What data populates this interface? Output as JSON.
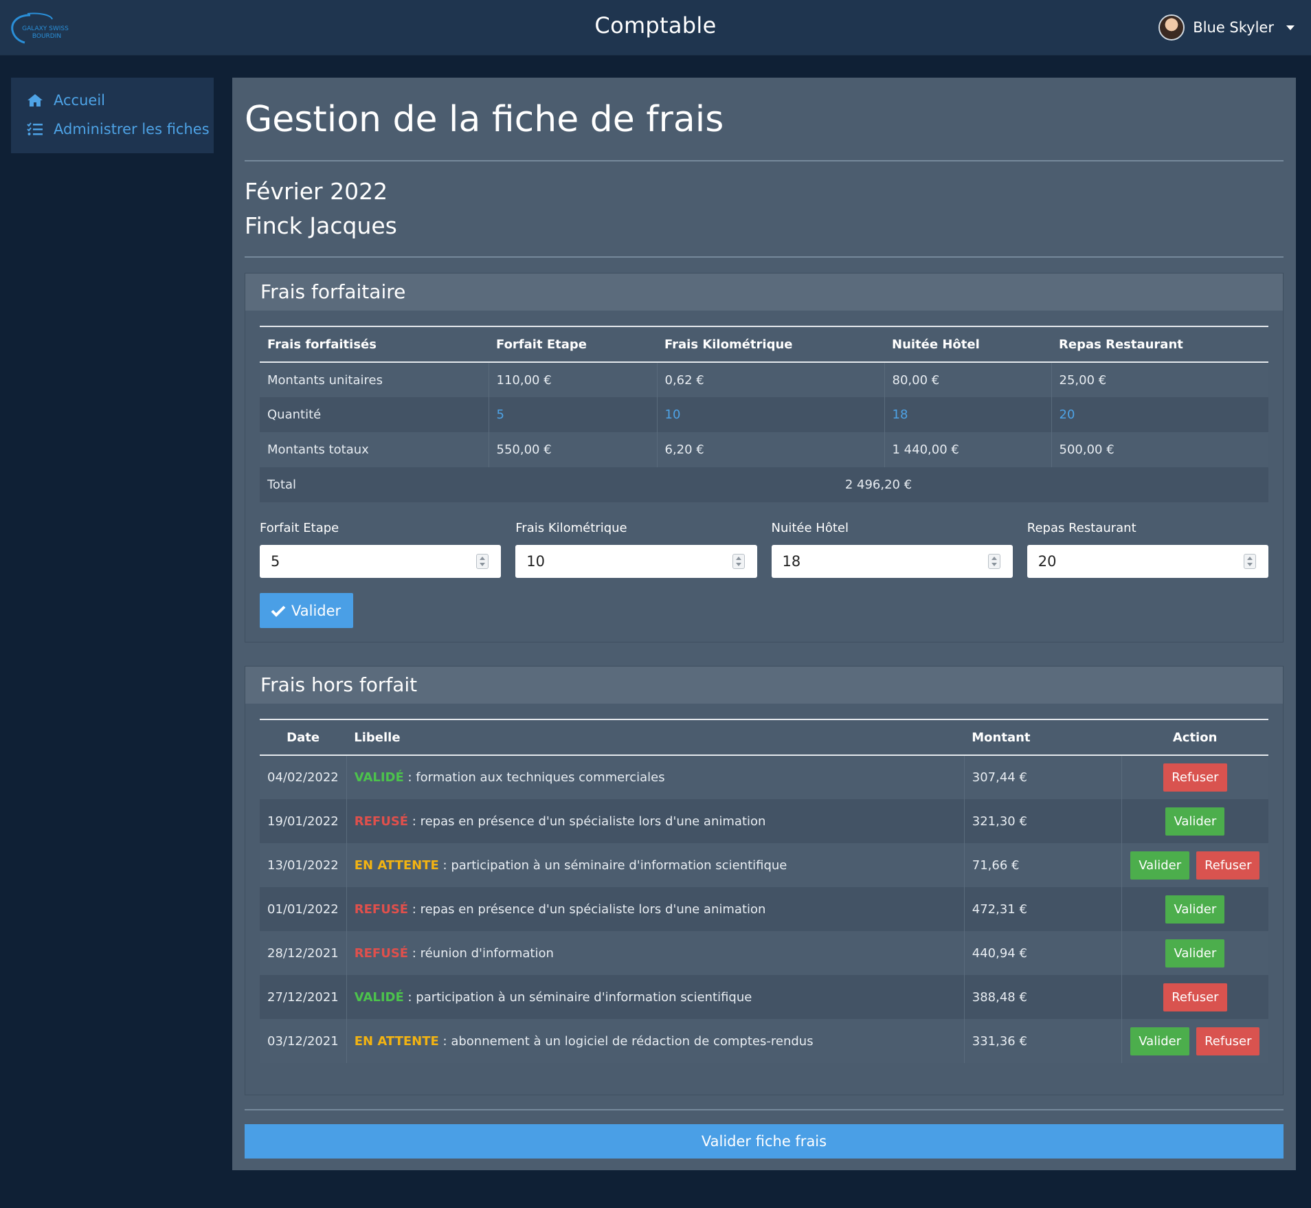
{
  "navbar": {
    "logo_text_line1": "GALAXY SWISS",
    "logo_text_line2": "BOURDIN",
    "title": "Comptable",
    "user_name": "Blue Skyler"
  },
  "sidebar": {
    "items": [
      {
        "label": "Accueil",
        "icon": "home-icon"
      },
      {
        "label": "Administrer les fiches",
        "icon": "list-check-icon"
      }
    ]
  },
  "page": {
    "title": "Gestion de la fiche de frais",
    "period": "Février 2022",
    "visitor": "Finck Jacques"
  },
  "frais_forfait": {
    "header": "Frais forfaitaire",
    "columns": [
      "Frais forfaitisés",
      "Forfait Etape",
      "Frais Kilométrique",
      "Nuitée Hôtel",
      "Repas Restaurant"
    ],
    "rows": [
      {
        "label": "Montants unitaires",
        "values": [
          "110,00 €",
          "0,62 €",
          "80,00 €",
          "25,00 €"
        ]
      },
      {
        "label": "Quantité",
        "values": [
          "5",
          "10",
          "18",
          "20"
        ]
      },
      {
        "label": "Montants totaux",
        "values": [
          "550,00 €",
          "6,20 €",
          "1 440,00 €",
          "500,00 €"
        ]
      }
    ],
    "total_label": "Total",
    "total_value": "2 496,20 €",
    "inputs": [
      {
        "label": "Forfait Etape",
        "value": "5"
      },
      {
        "label": "Frais Kilométrique",
        "value": "10"
      },
      {
        "label": "Nuitée Hôtel",
        "value": "18"
      },
      {
        "label": "Repas Restaurant",
        "value": "20"
      }
    ],
    "submit_label": "Valider"
  },
  "frais_hors_forfait": {
    "header": "Frais hors forfait",
    "columns": [
      "Date",
      "Libelle",
      "Montant",
      "Action"
    ],
    "rows": [
      {
        "date": "04/02/2022",
        "status": "VALIDÉ",
        "status_color": "#4cc34c",
        "text": " : formation aux techniques commerciales",
        "amount": "307,44 €",
        "actions": [
          "Refuser"
        ]
      },
      {
        "date": "19/01/2022",
        "status": "REFUSÉ",
        "status_color": "#e0504c",
        "text": " : repas en présence d'un spécialiste lors d'une animation",
        "amount": "321,30 €",
        "actions": [
          "Valider"
        ]
      },
      {
        "date": "13/01/2022",
        "status": "EN ATTENTE",
        "status_color": "#f2b312",
        "text": " : participation à un séminaire d'information scientifique",
        "amount": "71,66 €",
        "actions": [
          "Valider",
          "Refuser"
        ]
      },
      {
        "date": "01/01/2022",
        "status": "REFUSÉ",
        "status_color": "#e0504c",
        "text": " : repas en présence d'un spécialiste lors d'une animation",
        "amount": "472,31 €",
        "actions": [
          "Valider"
        ]
      },
      {
        "date": "28/12/2021",
        "status": "REFUSÉ",
        "status_color": "#e0504c",
        "text": " : réunion d'information",
        "amount": "440,94 €",
        "actions": [
          "Valider"
        ]
      },
      {
        "date": "27/12/2021",
        "status": "VALIDÉ",
        "status_color": "#4cc34c",
        "text": " : participation à un séminaire d'information scientifique",
        "amount": "388,48 €",
        "actions": [
          "Refuser"
        ]
      },
      {
        "date": "03/12/2021",
        "status": "EN ATTENTE",
        "status_color": "#f2b312",
        "text": " : abonnement à un logiciel de rédaction de comptes-rendus",
        "amount": "331,36 €",
        "actions": [
          "Valider",
          "Refuser"
        ]
      }
    ]
  },
  "footer_button": "Valider fiche frais",
  "colors": {
    "accent": "#4a9fe6",
    "success": "#4cae4c",
    "danger": "#d9534f",
    "warning": "#f2b312"
  }
}
